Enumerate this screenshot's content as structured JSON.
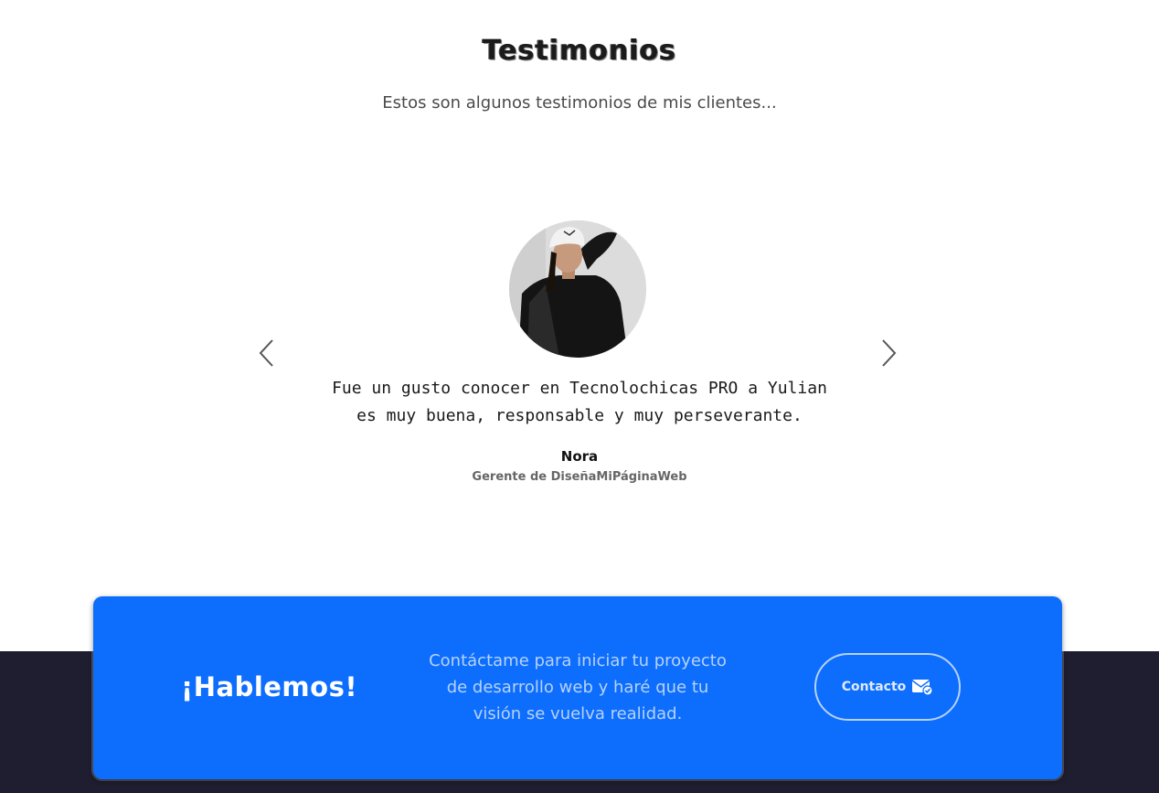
{
  "testimonials": {
    "title": "Testimonios",
    "subtitle": "Estos son algunos testimonios de mis clientes...",
    "current": {
      "quote_line1": "Fue un gusto conocer en Tecnolochicas PRO a Yulian",
      "quote_line2": "es muy buena, responsable y muy perseverante.",
      "name": "Nora",
      "role": "Gerente de DiseñaMiPáginaWeb"
    },
    "prev_icon": "chevron-left-icon",
    "next_icon": "chevron-right-icon"
  },
  "cta": {
    "title": "¡Hablemos!",
    "text_line1": "Contáctame para iniciar tu proyecto",
    "text_line2": "de desarrollo web y haré que tu",
    "text_line3": "visión se vuelva realidad.",
    "button_label": "Contacto",
    "button_icon": "envelope-check-icon"
  },
  "colors": {
    "accent": "#0d6efd",
    "footer": "#1e1e30",
    "cta_text": "#b6d2fb"
  }
}
